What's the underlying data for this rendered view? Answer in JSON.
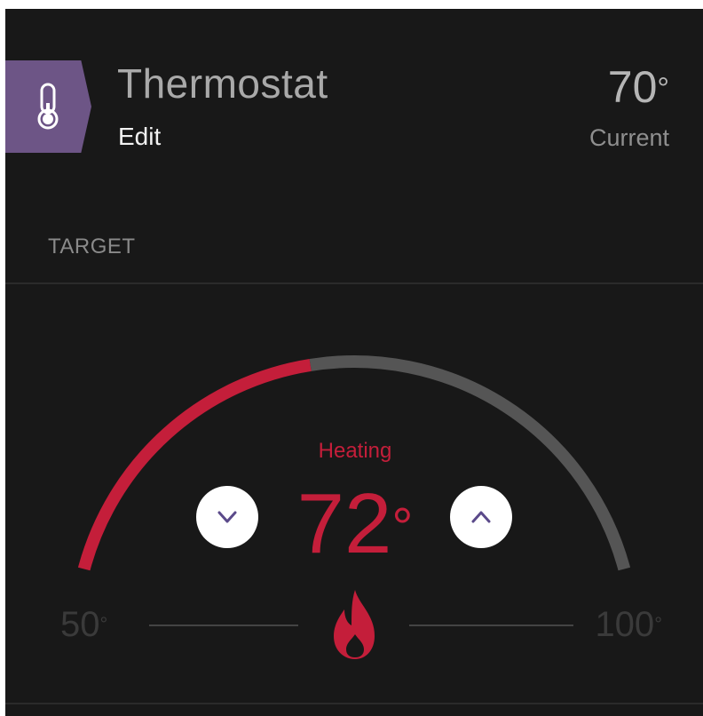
{
  "device": {
    "name": "Thermostat",
    "edit_label": "Edit",
    "icon": "thermometer-icon",
    "accent_color": "#6d5586"
  },
  "current": {
    "value": "70",
    "degree": "°",
    "label": "Current"
  },
  "target_section": {
    "label": "TARGET",
    "mode": "Heating",
    "value": "72",
    "degree": "°",
    "decrease_icon": "chevron-down-icon",
    "increase_icon": "chevron-up-icon",
    "mode_icon": "flame-icon",
    "heat_color": "#c41e3a"
  },
  "gauge": {
    "min": "50",
    "max": "100",
    "degree": "°",
    "level": 0.44
  }
}
